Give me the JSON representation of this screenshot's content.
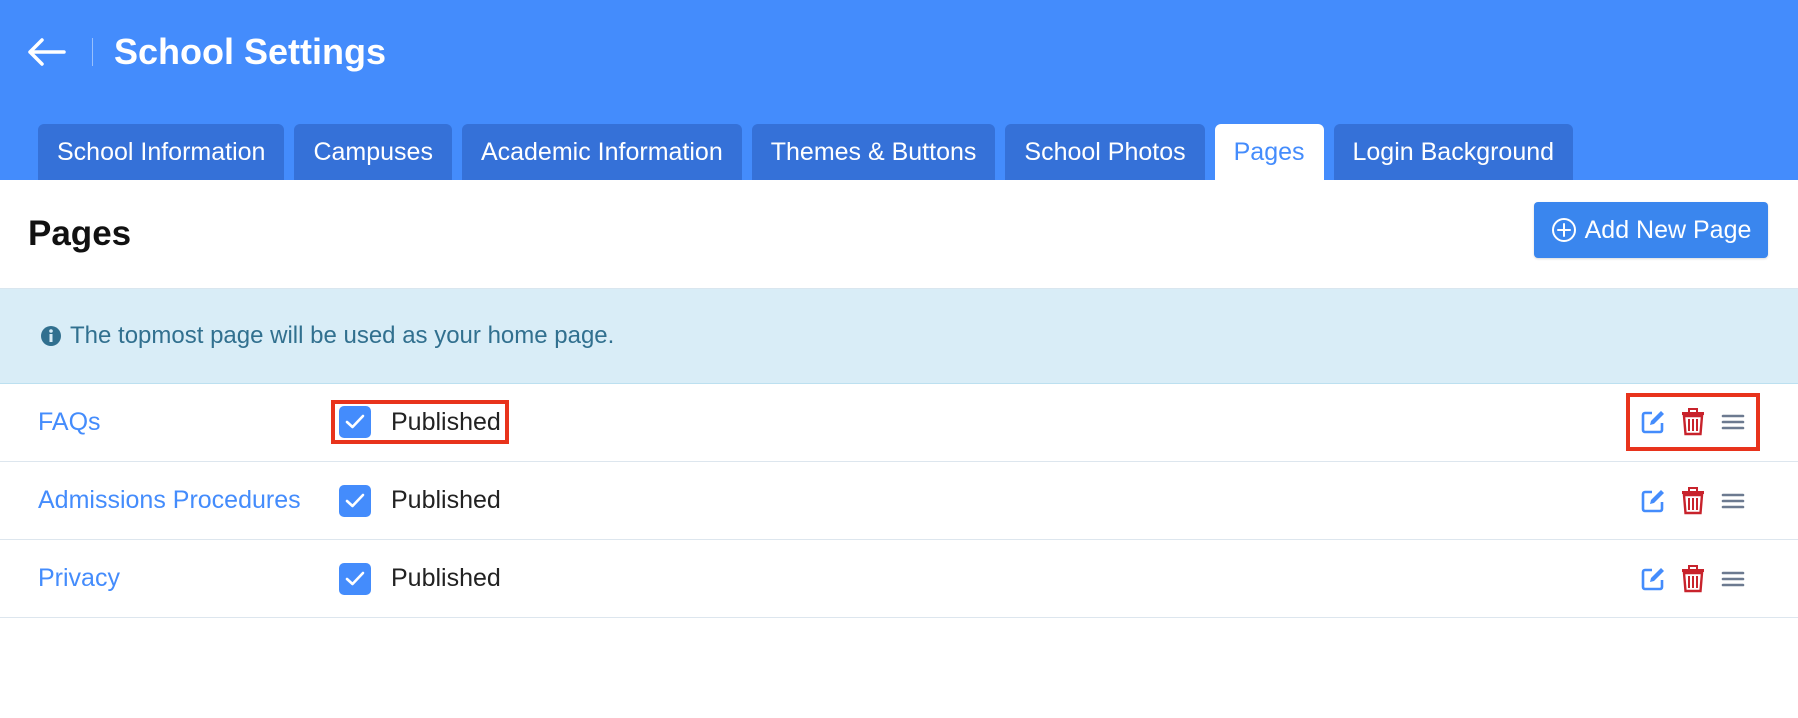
{
  "header": {
    "title": "School Settings",
    "back_icon": "arrow-left-icon",
    "background": "#448cfc"
  },
  "tabs": [
    {
      "label": "School Information",
      "active": false
    },
    {
      "label": "Campuses",
      "active": false
    },
    {
      "label": "Academic Information",
      "active": false
    },
    {
      "label": "Themes & Buttons",
      "active": false
    },
    {
      "label": "School Photos",
      "active": false
    },
    {
      "label": "Pages",
      "active": true
    },
    {
      "label": "Login Background",
      "active": false
    }
  ],
  "section": {
    "title": "Pages",
    "add_button_label": "Add New Page",
    "add_button_icon": "plus-circle-icon"
  },
  "info": {
    "icon": "info-circle-icon",
    "text": "The topmost page will be used as your home page."
  },
  "pages": [
    {
      "name": "FAQs",
      "status_label": "Published",
      "published": true
    },
    {
      "name": "Admissions Procedures",
      "status_label": "Published",
      "published": true
    },
    {
      "name": "Privacy",
      "status_label": "Published",
      "published": true
    }
  ],
  "colors": {
    "accent": "#448cfc",
    "tab_inactive": "#3571d8",
    "delete": "#c8232c",
    "highlight": "#e8331c"
  }
}
